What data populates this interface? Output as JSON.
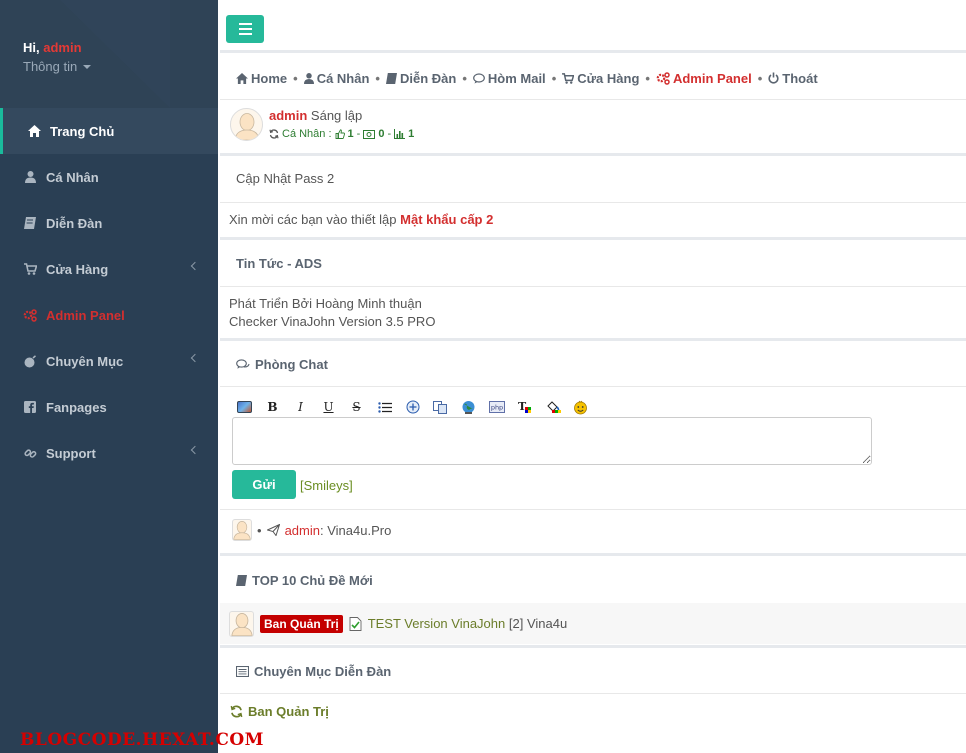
{
  "sidebar": {
    "greeting": "Hi,",
    "username": "admin",
    "info_label": "Thông tin",
    "items": [
      {
        "label": "Trang Chủ"
      },
      {
        "label": "Cá Nhân"
      },
      {
        "label": "Diễn Đàn"
      },
      {
        "label": "Cửa Hàng"
      },
      {
        "label": "Admin Panel"
      },
      {
        "label": "Chuyên Mục"
      },
      {
        "label": "Fanpages"
      },
      {
        "label": "Support"
      }
    ],
    "watermark": "BLOGCODE.HEXAT.COM"
  },
  "nav": {
    "items": [
      {
        "label": "Home"
      },
      {
        "label": "Cá Nhân"
      },
      {
        "label": "Diễn Đàn"
      },
      {
        "label": "Hòm Mail"
      },
      {
        "label": "Cửa Hàng"
      },
      {
        "label": "Admin Panel"
      },
      {
        "label": "Thoát"
      }
    ],
    "separator": "•"
  },
  "user": {
    "name": "admin",
    "role": "Sáng lập",
    "stats_label": "Cá Nhân :",
    "like_count": "1",
    "money_count": "0",
    "chart_count": "1",
    "dash": "-"
  },
  "notices": {
    "update_pass": "Cập Nhật Pass 2",
    "invite_text": "Xin mời các bạn vào thiết lập",
    "invite_link": "Mật khẩu cấp 2"
  },
  "news": {
    "title": "Tin Tức - ADS",
    "line1": "Phát Triển Bởi Hoàng Minh thuận",
    "line2": "Checker VinaJohn Version 3.5 PRO"
  },
  "chat": {
    "title": "Phòng Chat",
    "send_label": "Gửi",
    "smileys_label": "[Smileys]",
    "message_bullet": "•",
    "message_user": "admin",
    "message_text": ": Vina4u.Pro"
  },
  "top10": {
    "title": "TOP 10 Chủ Đề Mới",
    "badge": "Ban Quản Trị",
    "topic": "TEST Version VinaJohn",
    "suffix": "[2] Vina4u"
  },
  "forum": {
    "title": "Chuyên Mục Diễn Đàn",
    "category": "Ban Quản Trị"
  },
  "colors": {
    "sidebar_bg": "#2a3f54",
    "accent_green": "#26b99a",
    "admin_red": "#d32f2f",
    "olive": "#6b7d2a"
  }
}
